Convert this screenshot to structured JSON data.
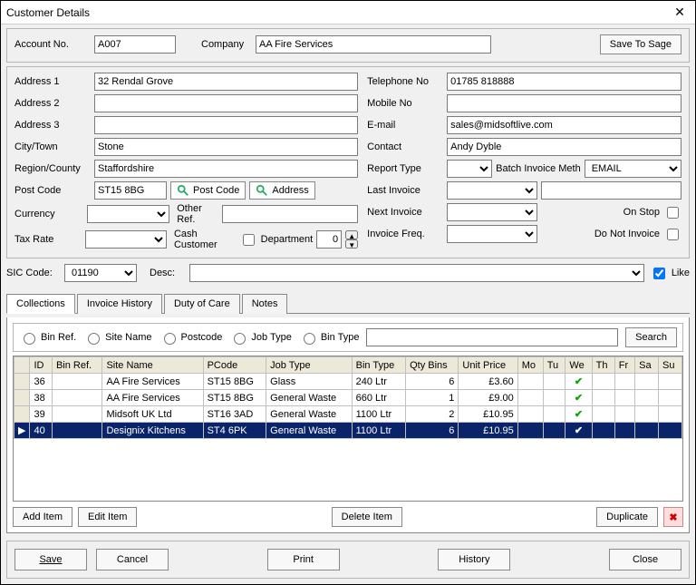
{
  "window": {
    "title": "Customer Details"
  },
  "header": {
    "account_label": "Account No.",
    "account_value": "A007",
    "company_label": "Company",
    "company_value": "AA Fire Services",
    "save_sage": "Save To Sage"
  },
  "left": {
    "addr1_l": "Address 1",
    "addr1_v": "32 Rendal Grove",
    "addr2_l": "Address 2",
    "addr2_v": "",
    "addr3_l": "Address 3",
    "addr3_v": "",
    "city_l": "City/Town",
    "city_v": "Stone",
    "region_l": "Region/County",
    "region_v": "Staffordshire",
    "post_l": "Post Code",
    "post_v": "ST15 8BG",
    "currency_l": "Currency",
    "tax_l": "Tax Rate",
    "postcode_btn": "Post Code",
    "address_btn": "Address",
    "otherref_l": "Other Ref.",
    "cashcust_l": "Cash Customer",
    "dept_l": "Department",
    "dept_v": "0"
  },
  "right": {
    "tel_l": "Telephone No",
    "tel_v": "01785 818888",
    "mob_l": "Mobile No",
    "mob_v": "",
    "email_l": "E-mail",
    "email_v": "sales@midsoftlive.com",
    "contact_l": "Contact",
    "contact_v": "Andy Dyble",
    "report_l": "Report Type",
    "batch_l": "Batch Invoice Meth",
    "batch_v": "EMAIL",
    "lastinv_l": "Last Invoice",
    "nextinv_l": "Next Invoice",
    "invfreq_l": "Invoice Freq.",
    "onstop_l": "On Stop",
    "dni_l": "Do Not Invoice"
  },
  "sic": {
    "label": "SIC Code:",
    "value": "01190",
    "desc_l": "Desc:",
    "like_l": "Like"
  },
  "tabs": {
    "t1": "Collections",
    "t2": "Invoice History",
    "t3": "Duty of Care",
    "t4": "Notes"
  },
  "search": {
    "binref": "Bin Ref.",
    "sitename": "Site Name",
    "postcode": "Postcode",
    "jobtype": "Job Type",
    "bintype": "Bin Type",
    "search_btn": "Search"
  },
  "columns": [
    "ID",
    "Bin Ref.",
    "Site Name",
    "PCode",
    "Job Type",
    "Bin Type",
    "Qty Bins",
    "Unit Price",
    "Mo",
    "Tu",
    "We",
    "Th",
    "Fr",
    "Sa",
    "Su"
  ],
  "rows": [
    {
      "id": "36",
      "bin": "",
      "site": "AA Fire Services",
      "pcode": "ST15 8BG",
      "job": "Glass",
      "btype": "240 Ltr",
      "qty": "6",
      "price": "£3.60",
      "days": [
        0,
        0,
        1,
        0,
        0,
        0,
        0
      ]
    },
    {
      "id": "38",
      "bin": "",
      "site": "AA Fire Services",
      "pcode": "ST15 8BG",
      "job": "General Waste",
      "btype": "660 Ltr",
      "qty": "1",
      "price": "£9.00",
      "days": [
        0,
        0,
        1,
        0,
        0,
        0,
        0
      ]
    },
    {
      "id": "39",
      "bin": "",
      "site": "Midsoft UK Ltd",
      "pcode": "ST16 3AD",
      "job": "General Waste",
      "btype": "1100 Ltr",
      "qty": "2",
      "price": "£10.95",
      "days": [
        0,
        0,
        1,
        0,
        0,
        0,
        0
      ]
    },
    {
      "id": "40",
      "bin": "",
      "site": "Designix Kitchens",
      "pcode": "ST4 6PK",
      "job": "General Waste",
      "btype": "1100 Ltr",
      "qty": "6",
      "price": "£10.95",
      "days": [
        0,
        0,
        1,
        0,
        0,
        0,
        0
      ],
      "selected": true
    }
  ],
  "itembtns": {
    "add": "Add Item",
    "edit": "Edit Item",
    "del": "Delete Item",
    "dup": "Duplicate"
  },
  "bottom": {
    "save": "Save",
    "cancel": "Cancel",
    "print": "Print",
    "history": "History",
    "close": "Close"
  }
}
